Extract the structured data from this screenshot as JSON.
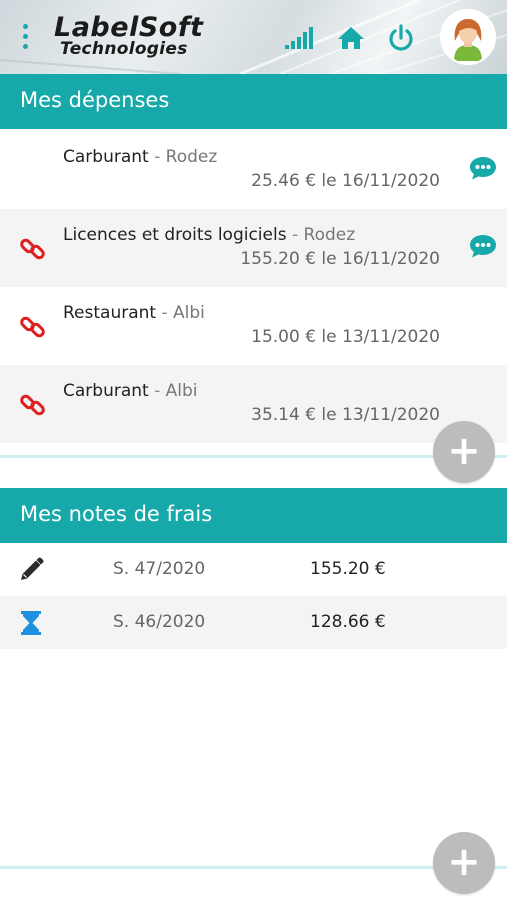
{
  "header": {
    "logo_line1": "LabelSoft",
    "logo_line2": "Technologies",
    "icons": [
      "menu-dots-icon",
      "signal-icon",
      "home-icon",
      "power-icon"
    ],
    "accent_color": "#17a9a9"
  },
  "expenses_section": {
    "title": "Mes dépenses",
    "items": [
      {
        "category": "Carburant",
        "city": "Rodez",
        "amount": "25.46 €",
        "date_prefix": "le",
        "date": "16/11/2020",
        "has_link_icon": false,
        "has_comment_icon": true
      },
      {
        "category": "Licences et droits logiciels",
        "city": "Rodez",
        "amount": "155.20 €",
        "date_prefix": "le",
        "date": "16/11/2020",
        "has_link_icon": true,
        "has_comment_icon": true
      },
      {
        "category": "Restaurant",
        "city": "Albi",
        "amount": "15.00 €",
        "date_prefix": "le",
        "date": "13/11/2020",
        "has_link_icon": true,
        "has_comment_icon": false
      },
      {
        "category": "Carburant",
        "city": "Albi",
        "amount": "35.14 €",
        "date_prefix": "le",
        "date": "13/11/2020",
        "has_link_icon": true,
        "has_comment_icon": false
      }
    ],
    "add_button": "+"
  },
  "notes_section": {
    "title": "Mes notes de frais",
    "items": [
      {
        "status_icon": "pencil-icon",
        "week": "S. 47/2020",
        "total": "155.20 €"
      },
      {
        "status_icon": "hourglass-icon",
        "week": "S. 46/2020",
        "total": "128.66 €"
      }
    ],
    "add_button": "+"
  }
}
